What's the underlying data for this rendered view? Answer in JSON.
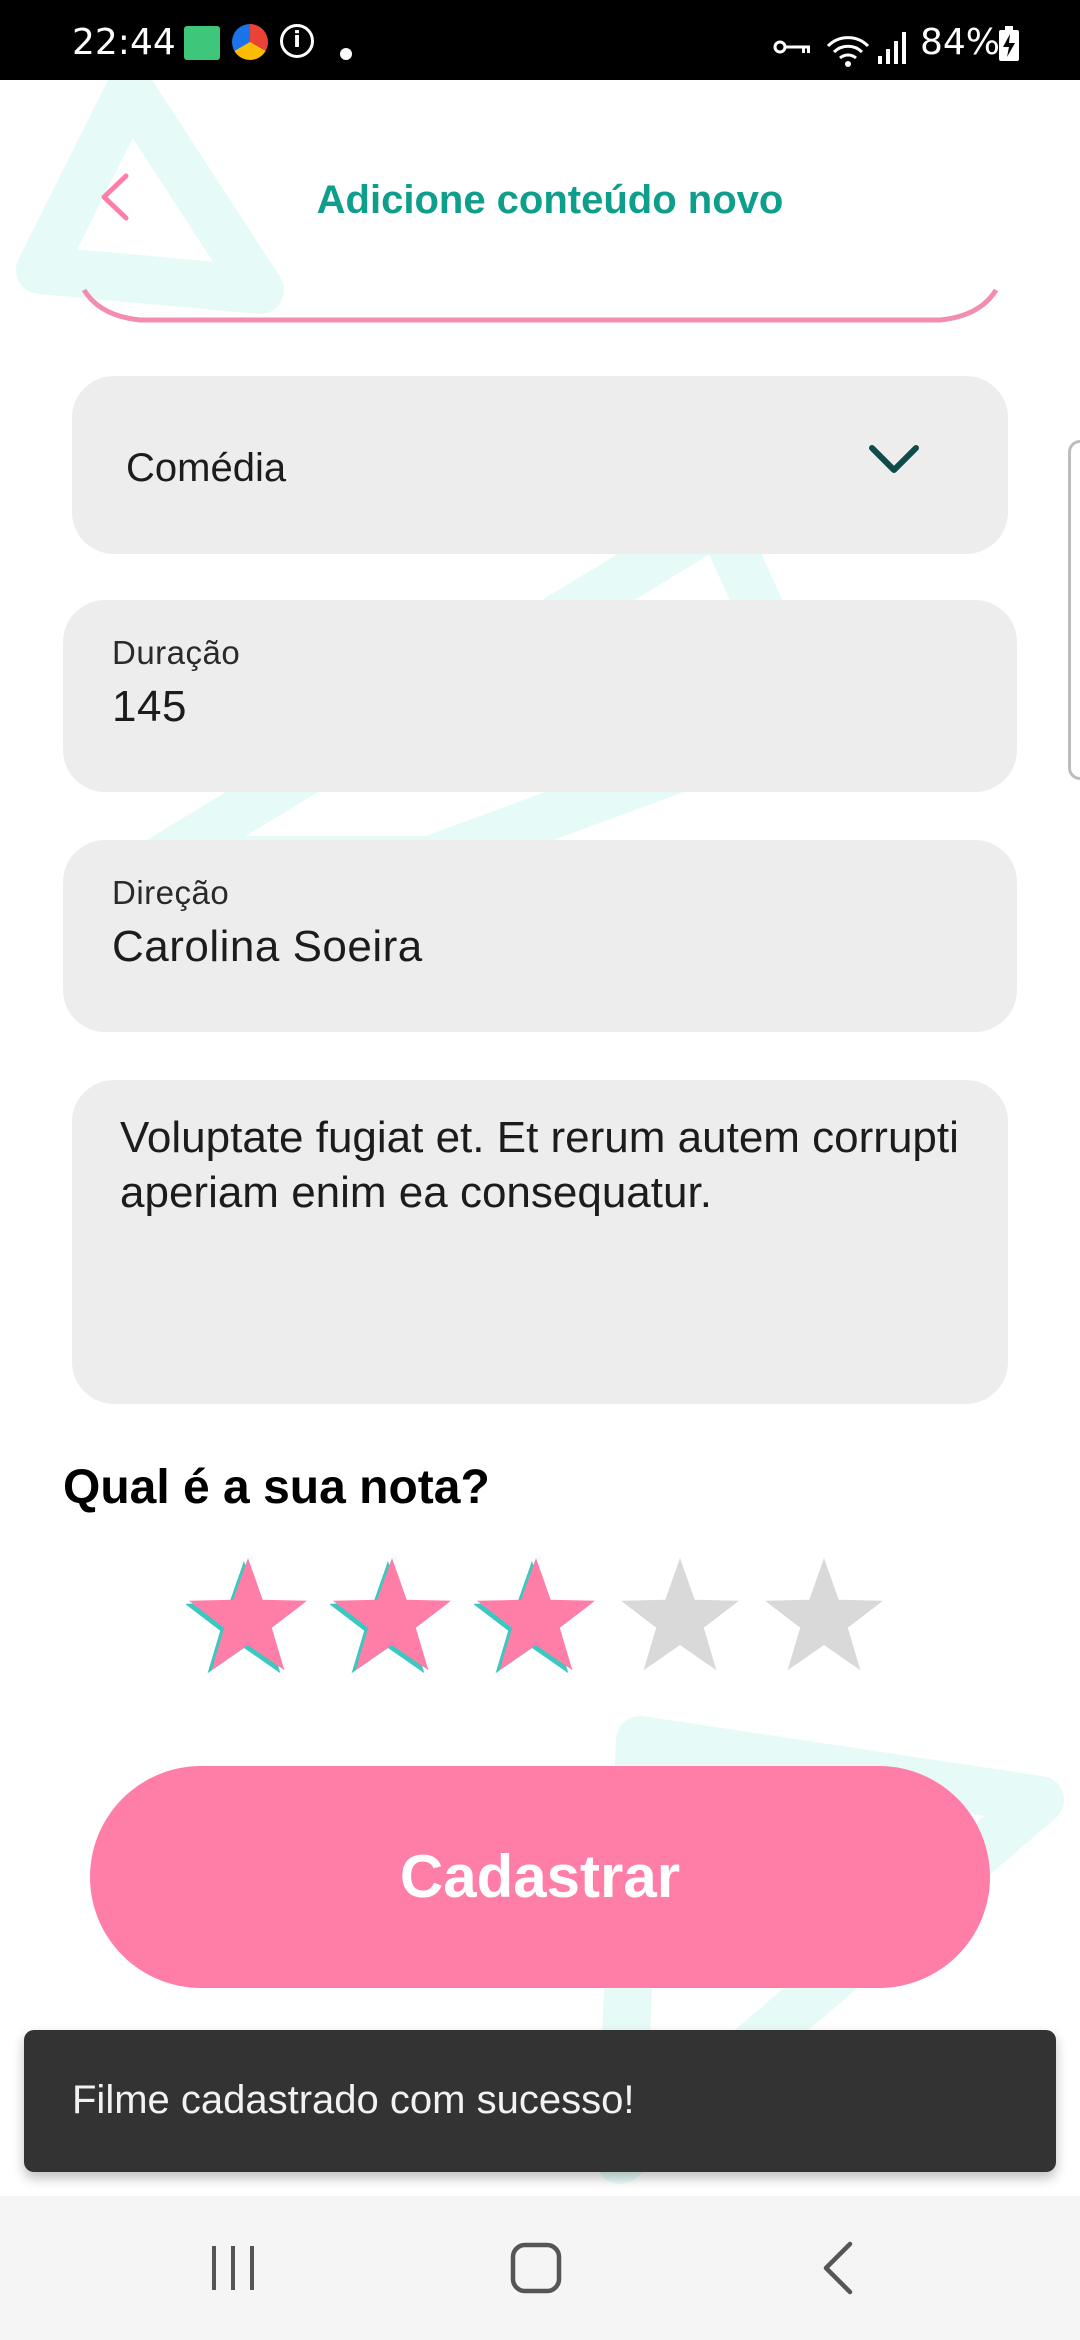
{
  "status_bar": {
    "time": "22:44",
    "battery": "84%"
  },
  "header": {
    "title": "Adicione conteúdo novo"
  },
  "form": {
    "genre": {
      "value": "Comédia"
    },
    "duration": {
      "label": "Duração",
      "value": "145"
    },
    "direction": {
      "label": "Direção",
      "value": "Carolina Soeira"
    },
    "description": {
      "value": "Voluptate fugiat et. Et rerum autem corrupti aperiam enim ea consequatur."
    }
  },
  "rating": {
    "question": "Qual é a sua nota?",
    "value": 3,
    "max": 5
  },
  "submit": {
    "label": "Cadastrar"
  },
  "snackbar": {
    "message": "Filme cadastrado com sucesso!"
  },
  "colors": {
    "accent_teal": "#0e9e8c",
    "accent_pink": "#ff7ea8",
    "star_filled": "#ff7ea8",
    "star_empty": "#d9d9d9",
    "field_bg": "#ededed"
  },
  "icons": {
    "back": "back-arrow-icon",
    "dropdown": "chevron-down-icon",
    "star": "star-icon"
  }
}
